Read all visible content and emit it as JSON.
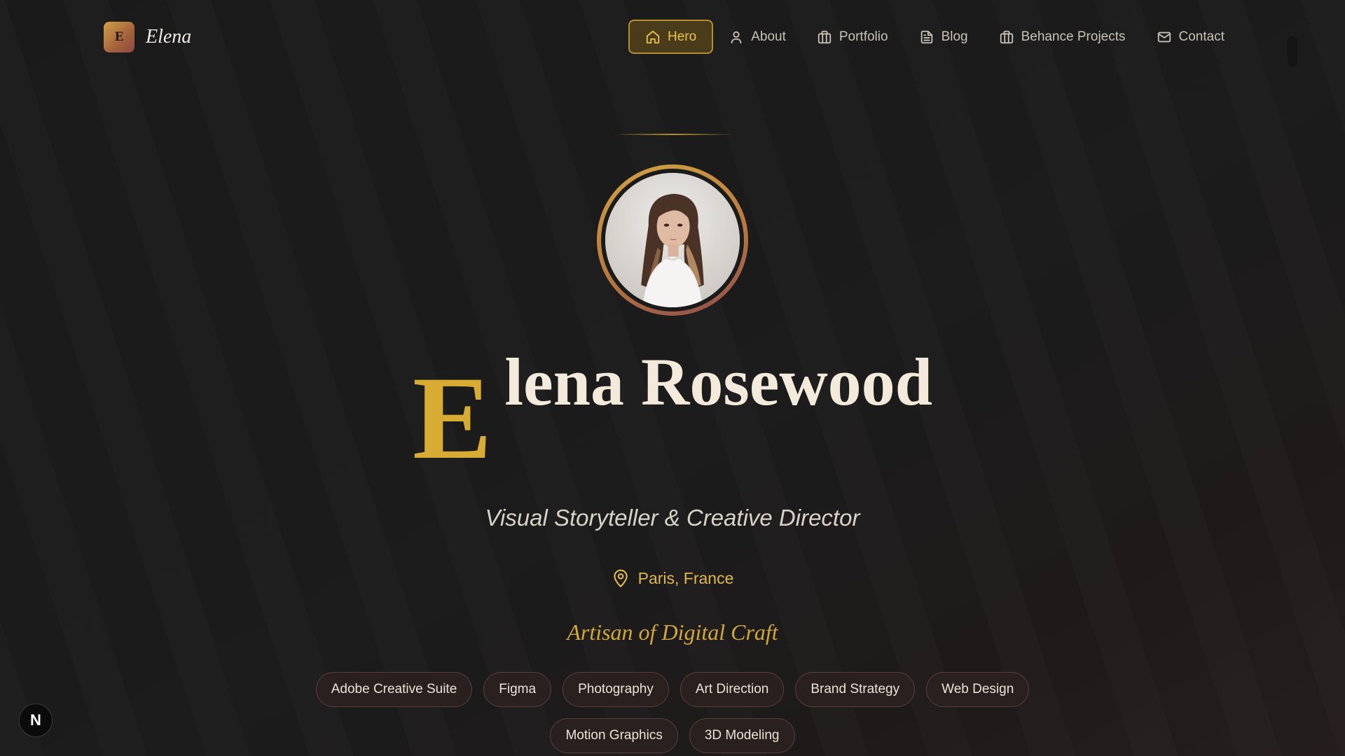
{
  "brand": {
    "initial": "E",
    "name": "Elena"
  },
  "nav": {
    "items": [
      {
        "label": "Hero",
        "icon": "home-icon",
        "active": true
      },
      {
        "label": "About",
        "icon": "user-icon"
      },
      {
        "label": "Portfolio",
        "icon": "briefcase-icon"
      },
      {
        "label": "Blog",
        "icon": "document-icon"
      },
      {
        "label": "Behance Projects",
        "icon": "briefcase-icon"
      },
      {
        "label": "Contact",
        "icon": "mail-icon"
      }
    ]
  },
  "hero": {
    "name_initial": "E",
    "name_rest": "lena Rosewood",
    "subtitle": "Visual Storyteller & Creative Director",
    "location": "Paris, France",
    "tagline": "Artisan of Digital Craft",
    "skills": [
      "Adobe Creative Suite",
      "Figma",
      "Photography",
      "Art Direction",
      "Brand Strategy",
      "Web Design",
      "Motion Graphics",
      "3D Modeling"
    ]
  },
  "dev_badge": {
    "label": "N"
  },
  "colors": {
    "background": "#1b1b1b",
    "accent_gold": "#d8ac32",
    "nav_active_bg": "#4a3c1a",
    "chip_bg": "#2b2020",
    "text": "#f4eadc"
  }
}
